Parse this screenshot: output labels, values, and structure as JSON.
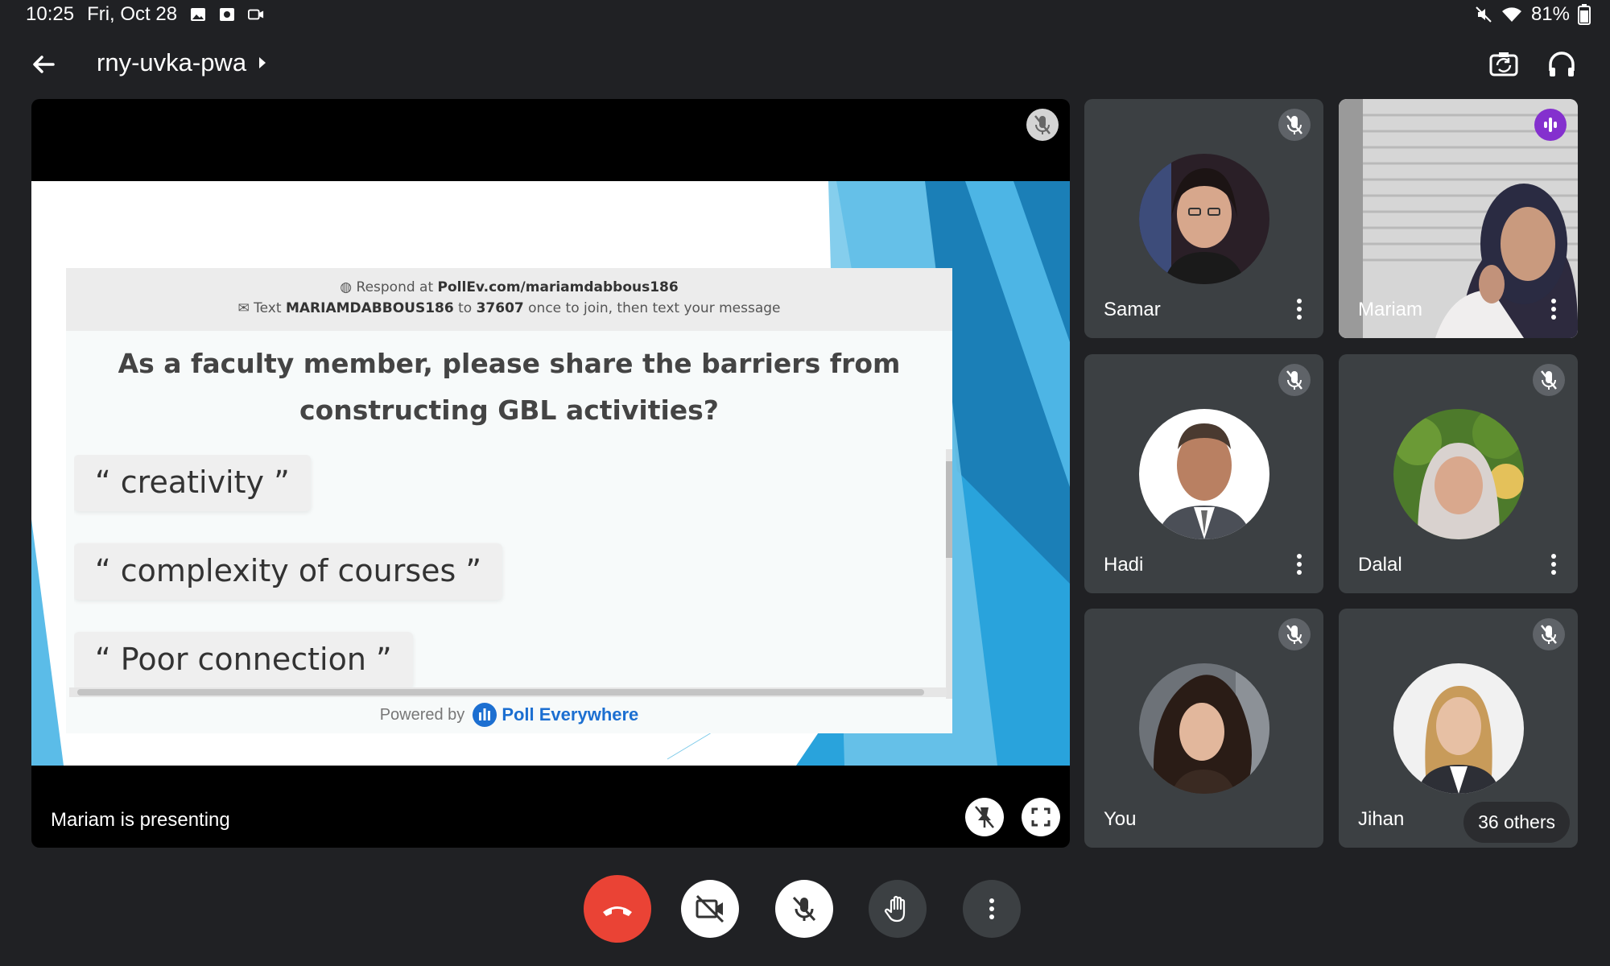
{
  "status": {
    "time": "10:25",
    "date": "Fri, Oct 28",
    "battery": "81%"
  },
  "meeting": {
    "code": "rny-uvka-pwa"
  },
  "stage": {
    "presenting_label": "Mariam is presenting",
    "poll": {
      "respond_prefix": "Respond at",
      "respond_url": "PollEv.com/mariamdabbous186",
      "text_prefix": "Text",
      "text_code": "MARIAMDABBOUS186",
      "text_to": "to",
      "text_number": "37607",
      "text_suffix": "once to join, then text your message",
      "question_line1": "As a faculty member, please share the barriers from",
      "question_line2": "constructing GBL activities?",
      "responses": [
        "“ creativity ”",
        "“ complexity of courses ”",
        "“ Poor connection ”"
      ],
      "powered_by": "Powered by",
      "brand": "Poll Everywhere"
    }
  },
  "participants": [
    {
      "name": "Samar",
      "muted": true
    },
    {
      "name": "Mariam",
      "speaking": true
    },
    {
      "name": "Hadi",
      "muted": true
    },
    {
      "name": "Dalal",
      "muted": true
    },
    {
      "name": "You",
      "muted": true
    },
    {
      "name": "Jihan",
      "muted": true
    }
  ],
  "others_count_label": "36 others",
  "colors": {
    "background": "#202124",
    "tile": "#3c4043",
    "end_call": "#ea4335",
    "speaking": "#8430ce",
    "poll_blue": "#1c6fd1"
  }
}
